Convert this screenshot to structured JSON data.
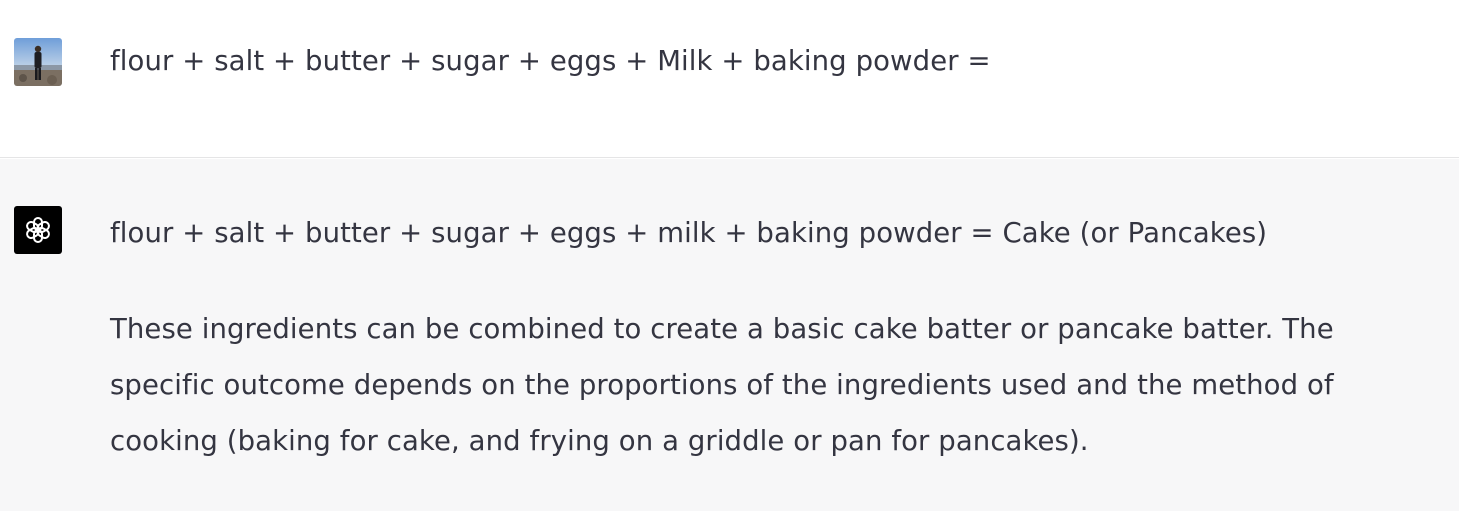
{
  "messages": {
    "user": {
      "avatar": "user-photo",
      "text": "flour + salt + butter + sugar + eggs + Milk + baking powder ="
    },
    "assistant": {
      "avatar": "openai-logo-icon",
      "answer": "flour + salt + butter + sugar + eggs + milk + baking powder = Cake (or Pancakes)",
      "explanation": "These ingredients can be combined to create a basic cake batter or pancake batter. The specific outcome depends on the proportions of the ingredients used and the method of cooking (baking for cake, and frying on a griddle or pan for pancakes)."
    }
  },
  "colors": {
    "text": "#343541",
    "user_bg": "#ffffff",
    "assistant_bg": "#f7f7f8",
    "divider": "#e5e5e6",
    "assistant_avatar_bg": "#000000"
  }
}
